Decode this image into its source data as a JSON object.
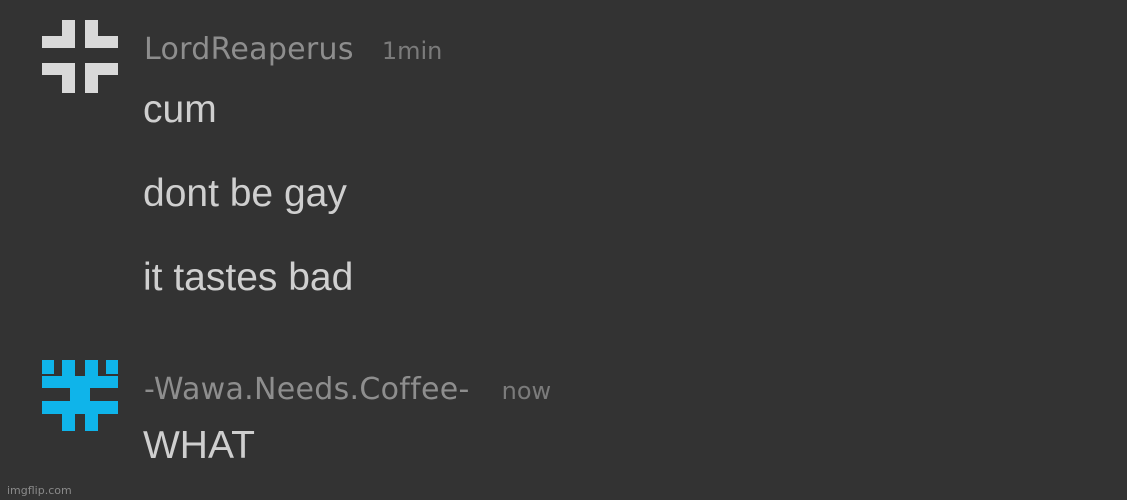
{
  "messages": [
    {
      "avatar_icon": "reaper-cross-glyph-icon",
      "avatar_color": "#d9d9d9",
      "username": "LordReaperus",
      "timestamp": "1min",
      "lines": [
        "cum",
        "dont be gay",
        "it tastes bad"
      ]
    },
    {
      "avatar_icon": "coffee-glyph-icon",
      "avatar_color": "#0fb4ea",
      "username": "-Wawa.Needs.Coffee-",
      "timestamp": "now",
      "lines": [
        "WHAT"
      ]
    }
  ],
  "watermark": "imgflip.com"
}
